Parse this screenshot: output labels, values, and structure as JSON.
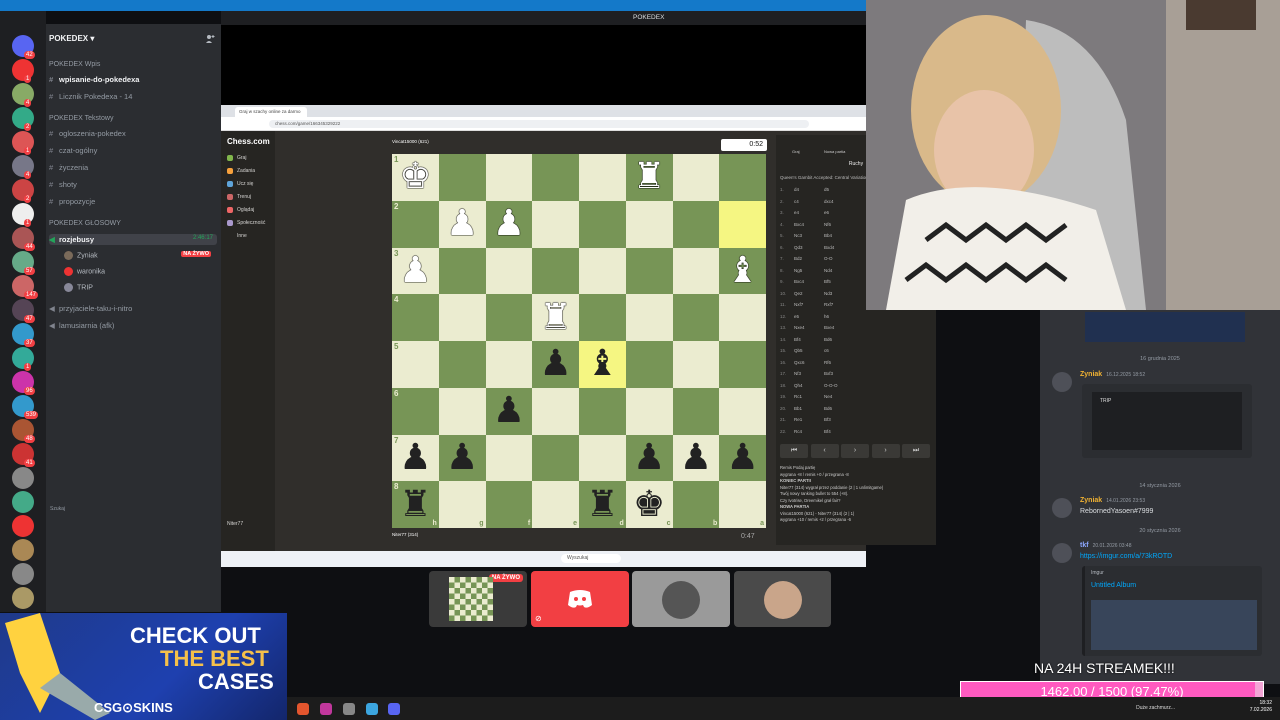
{
  "discord": {
    "server_name": "POKEDEX",
    "window_title": "POKEDEX",
    "categories": [
      "POKEDEX Wpis",
      "POKEDEX Tekstowy",
      "POKEDEX GŁOSOWY"
    ],
    "channels_wpis": [
      "wpisanie-do-pokedexa",
      "Licznik Pokedexa - 14"
    ],
    "channels_text": [
      "ogloszenia-pokedex",
      "czat-ogólny",
      "życzenia",
      "shoty",
      "propozycje"
    ],
    "voice_channel": "rozjebusy",
    "voice_time": "2:46:17",
    "voice_users": [
      {
        "name": "Zyniak",
        "badge": "NA ŻYWO"
      },
      {
        "name": "waronika",
        "badge": ""
      },
      {
        "name": "TRIP",
        "badge": ""
      }
    ],
    "voice_other": [
      "przyjaciele-taku-i-nitro",
      "lamusiarnia (afk)"
    ],
    "rail_badges": [
      "42",
      "1",
      "4",
      "2",
      "1",
      "4",
      "2",
      "1",
      "44",
      "57",
      "147",
      "47",
      "37",
      "1",
      "96",
      "539",
      "48",
      "41"
    ],
    "live_badge": "NA ŻYWO"
  },
  "browser": {
    "tab_title": "Graj w szachy online za darmo",
    "url": "chess.com/game/166345329222"
  },
  "chess": {
    "logo": "Chess.com",
    "nav": [
      "Graj",
      "Zadania",
      "Ucz się",
      "Trenuj",
      "Oglądaj",
      "Społeczność",
      "Inne"
    ],
    "nav_bottom": [
      "Szukaj",
      "Niter77"
    ],
    "player_top": "Vincat15000 (621)",
    "player_bottom": "Niter77 (314)",
    "clock_top": "0:52",
    "clock_bottom": "0:47",
    "panel_tabs": [
      "Graj",
      "Nowa partia"
    ],
    "panel_heading": "Ruchy",
    "opening": "Queen's Gambit Accepted: Central Variation",
    "moves": [
      [
        "1.",
        "d4",
        "d5"
      ],
      [
        "2.",
        "c4",
        "dxc4"
      ],
      [
        "3.",
        "e4",
        "e6"
      ],
      [
        "4.",
        "Bxc4",
        "Nf6"
      ],
      [
        "5.",
        "Nc3",
        "Bb4"
      ],
      [
        "6.",
        "Qd3",
        "Bxd4"
      ],
      [
        "7.",
        "Bd2",
        "O-O"
      ],
      [
        "8.",
        "Ng5",
        "Nd4"
      ],
      [
        "9.",
        "Bxc4",
        "Bf5"
      ],
      [
        "10.",
        "Qe2",
        "Nd3"
      ],
      [
        "11.",
        "Nxf7",
        "Rxf7"
      ],
      [
        "12.",
        "e5",
        "h6"
      ],
      [
        "13.",
        "Nxe4",
        "Bxe4"
      ],
      [
        "14.",
        "Bf4",
        "Bd6"
      ],
      [
        "15.",
        "Qb5",
        "c6"
      ],
      [
        "16.",
        "Qxc6",
        "Rf6"
      ],
      [
        "17.",
        "Nf3",
        "Bxf3"
      ],
      [
        "18.",
        "Qh4",
        "O-O-O"
      ],
      [
        "19.",
        "Rc1",
        "Ne4"
      ],
      [
        "20.",
        "Bb1",
        "Bd6"
      ],
      [
        "21.",
        "Re1",
        "Bf3"
      ],
      [
        "22.",
        "Rc4",
        "Bf4"
      ]
    ],
    "nav_buttons": [
      "⏮",
      "‹",
      "›",
      "›",
      "⏭"
    ],
    "log": [
      "Remis    Podaj partię",
      "wygrana +8 / remis +0 / przegrana -8",
      "KONIEC PARTII",
      "Niter77 (314) wygrał przez poddanie (2 | 1 unlimitgame)",
      "Twój nowy ranking bullet to 554 (+8).",
      "Czy Ivotrise, Dreemikel grał fair?",
      "NOWA PARTIA",
      "Vincat15000 (621) - Niter77 (314) (2 | 1)",
      "wygrana +10 / remis +2 / przegrana -6"
    ],
    "ranks": [
      "1",
      "2",
      "3",
      "4",
      "5",
      "6",
      "7",
      "8"
    ],
    "files": [
      "h",
      "g",
      "f",
      "e",
      "d",
      "c",
      "b",
      "a"
    ],
    "board": [
      [
        "wK",
        "",
        "",
        "",
        "",
        "wR",
        "",
        ""
      ],
      [
        "",
        "wP",
        "wP",
        "",
        "",
        "",
        "",
        "HL"
      ],
      [
        "wP",
        "",
        "",
        "",
        "",
        "",
        "",
        "wB"
      ],
      [
        "",
        "",
        "",
        "wR",
        "",
        "",
        "",
        ""
      ],
      [
        "",
        "",
        "",
        "bP",
        "bB*",
        "",
        "",
        ""
      ],
      [
        "",
        "",
        "bP",
        "",
        "",
        "",
        "",
        ""
      ],
      [
        "bP",
        "bP",
        "",
        "",
        "",
        "bP",
        "bP",
        "bP"
      ],
      [
        "bR",
        "",
        "",
        "",
        "bR",
        "bK",
        "",
        ""
      ]
    ],
    "taskbar_search": "Wyszukaj"
  },
  "chat": {
    "dates": [
      "16 grudnia 2025",
      "14 stycznia 2026",
      "20 stycznia 2026"
    ],
    "messages": [
      {
        "author": "Zyniak",
        "time": "16.12.2025 18:52",
        "text": "",
        "embed": "TRIP"
      },
      {
        "author": "Zyniak",
        "time": "14.01.2026 23:53",
        "text": "RebornedYasoen#7999"
      },
      {
        "author": "tkf",
        "time": "20.01.2026 03:48",
        "text": "https://imgur.com/a/73kROTD",
        "embed_source": "Imgur",
        "embed_title": "Untitled Album"
      }
    ]
  },
  "tiles": [
    {
      "label": "NA ŻYWO"
    },
    {
      "label": ""
    },
    {
      "label": ""
    },
    {
      "label": ""
    }
  ],
  "ad": {
    "line1": "CHECK OUT",
    "line2": "THE BEST",
    "line3": "CASES",
    "brand": "CSG⊙SKINS"
  },
  "goal": {
    "label": "NA 24H STREAMEK!!!",
    "text": "1462.00 / 1500 (97.47%)",
    "fraction": 0.9747
  },
  "wintaskbar": {
    "tray": "Duże zachmurz...",
    "time": "18:32",
    "date": "7.02.2026"
  },
  "colors": {
    "accent": "#1479c9",
    "discord_red": "#f23f43",
    "board_light": "#ebecd0",
    "board_dark": "#779556",
    "goal_pink": "#ff5ac0"
  }
}
